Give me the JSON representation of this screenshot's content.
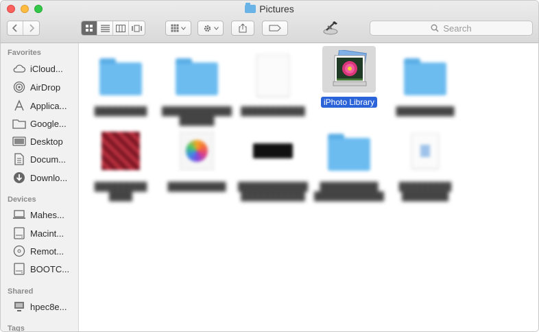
{
  "window": {
    "title": "Pictures",
    "search_placeholder": "Search"
  },
  "sidebar": {
    "favorites_header": "Favorites",
    "favorites": [
      {
        "label": "iCloud...",
        "icon": "cloud-icon"
      },
      {
        "label": "AirDrop",
        "icon": "airdrop-icon"
      },
      {
        "label": "Applica...",
        "icon": "applications-icon"
      },
      {
        "label": "Google...",
        "icon": "folder-icon"
      },
      {
        "label": "Desktop",
        "icon": "desktop-icon"
      },
      {
        "label": "Docum...",
        "icon": "documents-icon"
      },
      {
        "label": "Downlo...",
        "icon": "downloads-icon"
      }
    ],
    "devices_header": "Devices",
    "devices": [
      {
        "label": "Mahes...",
        "icon": "laptop-icon"
      },
      {
        "label": "Macint...",
        "icon": "hard-drive-icon"
      },
      {
        "label": "Remot...",
        "icon": "remote-disc-icon"
      },
      {
        "label": "BOOTC...",
        "icon": "hard-drive-icon"
      }
    ],
    "shared_header": "Shared",
    "shared": [
      {
        "label": "hpec8e...",
        "icon": "network-computer-icon"
      }
    ],
    "tags_header": "Tags"
  },
  "files": {
    "selected_label": "iPhoto Library"
  },
  "colors": {
    "folder": "#6cbcf0",
    "selection": "#2b63d8"
  }
}
